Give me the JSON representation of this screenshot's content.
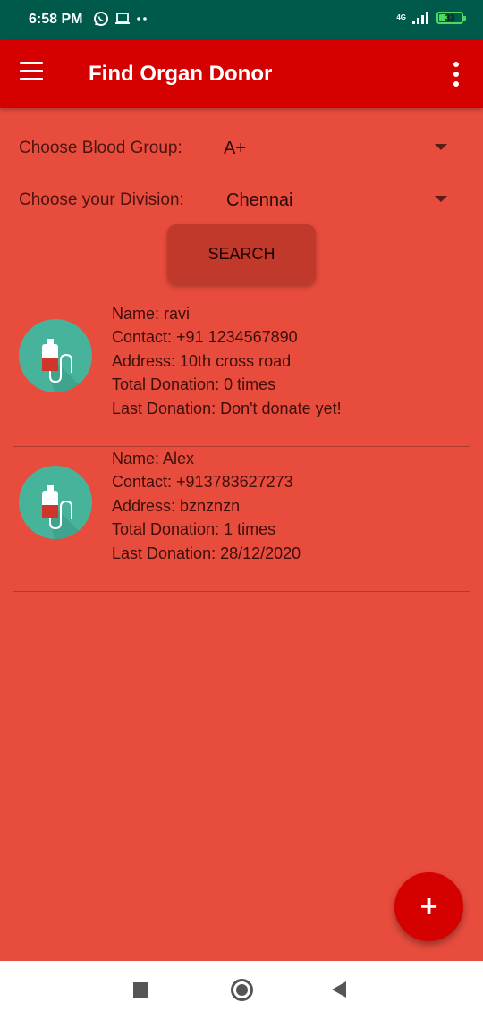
{
  "status_bar": {
    "time": "6:58 PM",
    "network": "4G",
    "battery": "33",
    "icons": [
      "whatsapp-icon",
      "laptop-icon",
      "more-dots-icon",
      "signal-icon",
      "battery-icon"
    ]
  },
  "app_bar": {
    "title": "Find Organ Donor",
    "icons": [
      "menu-icon",
      "overflow-menu-icon"
    ]
  },
  "filters": {
    "blood_group_label": "Choose Blood Group:",
    "blood_group_value": "A+",
    "division_label": "Choose your Division:",
    "division_value": "Chennai"
  },
  "search_button": "SEARCH",
  "donors": [
    {
      "name": "Name: ravi",
      "contact": "Contact: +91 1234567890",
      "address": "Address: 10th cross road",
      "total": "Total Donation: 0 times",
      "last": "Last Donation: Don't donate yet!"
    },
    {
      "name": "Name: Alex",
      "contact": "Contact: +913783627273",
      "address": "Address: bznznzn",
      "total": "Total Donation: 1 times",
      "last": "Last Donation: 28/12/2020"
    }
  ],
  "fab": {
    "label": "+",
    "icon": "add-icon"
  },
  "nav_bar": {
    "icons": [
      "recents-square-icon",
      "home-circle-icon",
      "back-triangle-icon"
    ]
  },
  "colors": {
    "status_bar": "#005a4c",
    "app_bar": "#d50000",
    "background": "#e84c3d",
    "avatar": "#47b39a",
    "button": "#c0392b"
  }
}
